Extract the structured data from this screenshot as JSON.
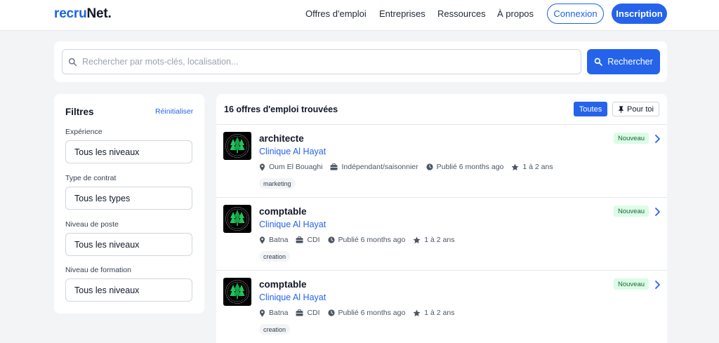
{
  "brand": {
    "part1": "recru",
    "part2": "Net."
  },
  "nav": {
    "links": [
      "Offres d'emploi",
      "Entreprises",
      "Ressources",
      "À propos"
    ],
    "login": "Connexion",
    "signup": "Inscription"
  },
  "search": {
    "placeholder": "Rechercher par mots-clés, localisation...",
    "value": "",
    "button": "Rechercher"
  },
  "filters": {
    "title": "Filtres",
    "reset": "Réinitialiser",
    "groups": [
      {
        "label": "Expérience",
        "value": "Tous les niveaux"
      },
      {
        "label": "Type de contrat",
        "value": "Tous les types"
      },
      {
        "label": "Niveau de poste",
        "value": "Tous les niveaux"
      },
      {
        "label": "Niveau de formation",
        "value": "Tous les niveaux"
      }
    ]
  },
  "results": {
    "count_text": "16 offres d'emploi trouvées",
    "tab_all": "Toutes",
    "tab_foryou": "Pour toi",
    "jobs": [
      {
        "title": "architecte",
        "company": "Clinique Al Hayat",
        "location": "Oum El Bouaghi",
        "contract": "Indépendant/saisonnier",
        "posted": "Publié 6 months ago",
        "experience": "1 à 2 ans",
        "tag": "marketing",
        "badge": "Nouveau"
      },
      {
        "title": "comptable",
        "company": "Clinique Al Hayat",
        "location": "Batna",
        "contract": "CDI",
        "posted": "Publié 6 months ago",
        "experience": "1 à 2 ans",
        "tag": "creation",
        "badge": "Nouveau"
      },
      {
        "title": "comptable",
        "company": "Clinique Al Hayat",
        "location": "Batna",
        "contract": "CDI",
        "posted": "Publié 6 months ago",
        "experience": "1 à 2 ans",
        "tag": "creation",
        "badge": "Nouveau"
      }
    ]
  },
  "colors": {
    "accent": "#2563eb",
    "badge_bg": "#dcfce7",
    "badge_text": "#166534",
    "logo_tree": "#22c55e"
  }
}
